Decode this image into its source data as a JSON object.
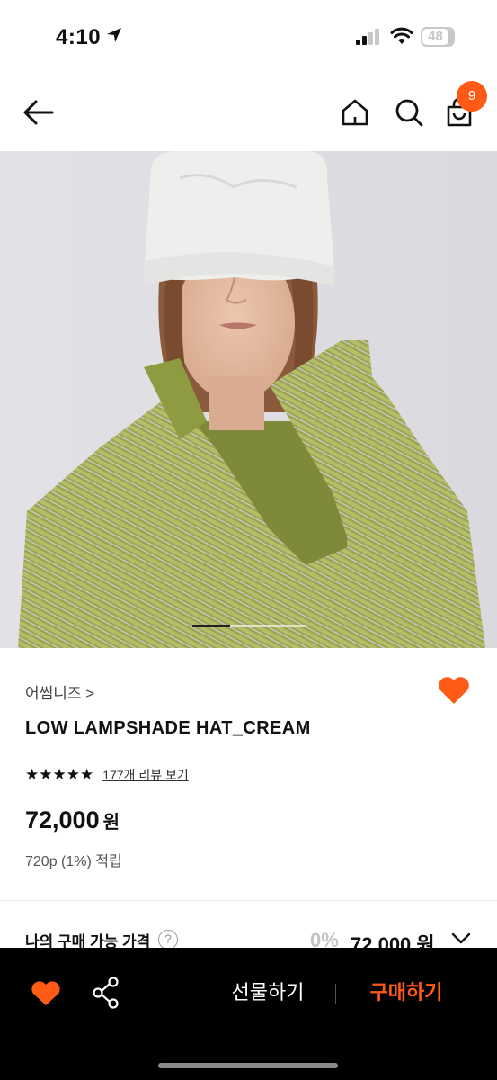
{
  "status_bar": {
    "time": "4:10",
    "battery": "48"
  },
  "nav": {
    "cart_count": "9"
  },
  "product": {
    "brand": "어썸니즈 >",
    "title": "LOW LAMPSHADE HAT_CREAM",
    "stars": "★★★★★",
    "review_link": "177개 리뷰 보기",
    "price": "72,000",
    "price_unit": "원",
    "points": "720p (1%) 적립",
    "image_page_fraction": 0.33
  },
  "my_price": {
    "label": "나의 구매 가능 가격",
    "help": "?",
    "discount": "0%",
    "value": "72,000 원"
  },
  "bottom_bar": {
    "gift_label": "선물하기",
    "buy_label": "구매하기"
  },
  "colors": {
    "accent": "#ff5a16",
    "bottom_bar_bg": "#000000"
  }
}
